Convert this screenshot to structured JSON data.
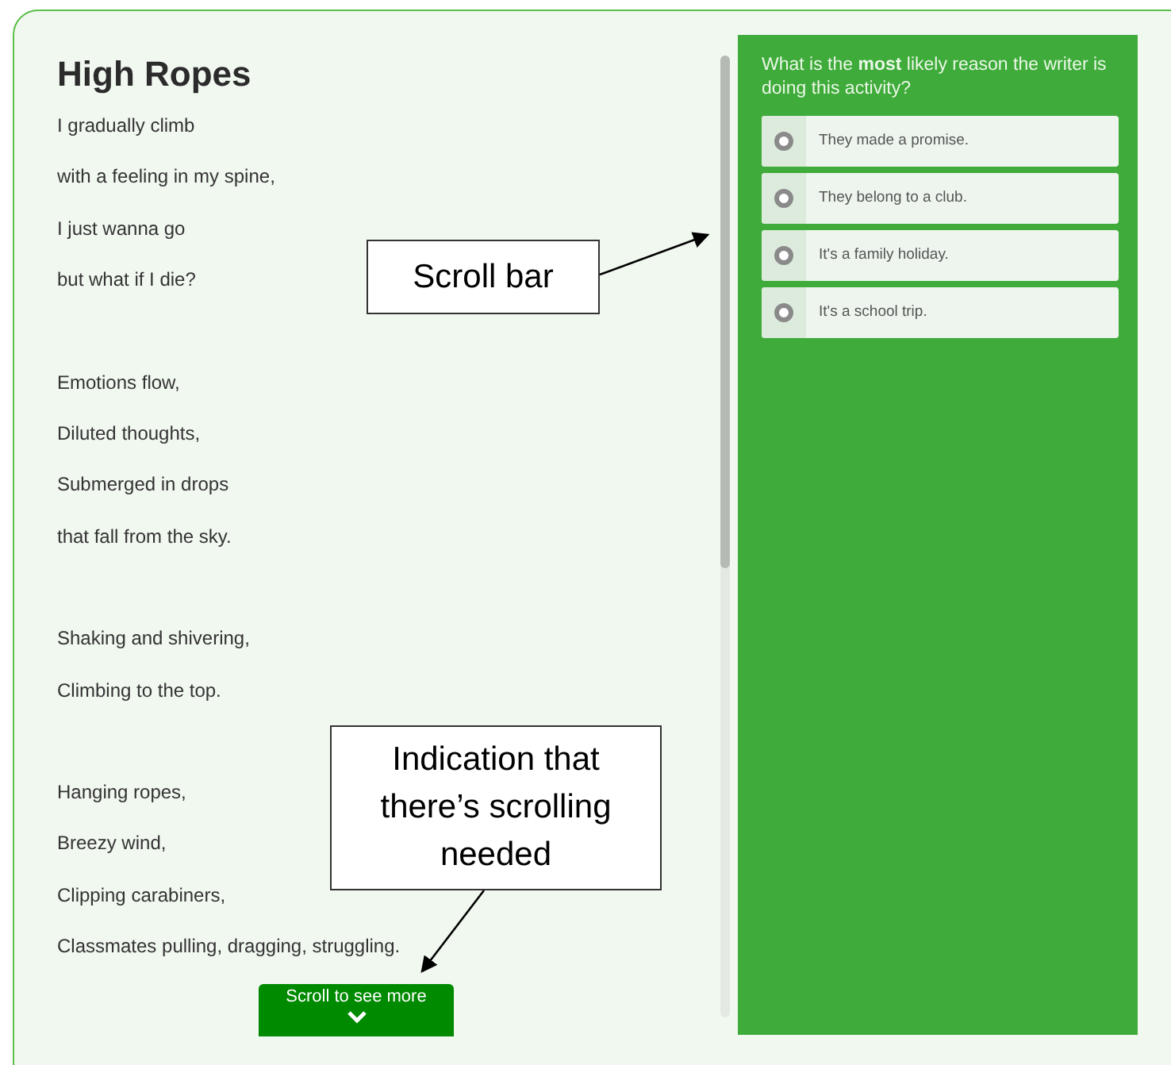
{
  "poem": {
    "title": "High Ropes",
    "stanzas": [
      [
        "I gradually climb",
        "with a feeling in my spine,",
        "I just wanna go",
        "but what if I die?"
      ],
      [
        "Emotions flow,",
        "Diluted thoughts,",
        "Submerged in drops",
        "that fall from the sky."
      ],
      [
        "Shaking and shivering,",
        "Climbing to the top."
      ],
      [
        "Hanging ropes,",
        "Breezy wind,",
        "Clipping carabiners,",
        "Classmates pulling, dragging, struggling."
      ]
    ],
    "scroll_button": "Scroll to see more"
  },
  "question": {
    "text": "What is the **most** likely reason the writer is doing this activity?",
    "options": [
      {
        "label": "They made a promise.",
        "selected": false
      },
      {
        "label": "They belong to a club.",
        "selected": false
      },
      {
        "label": "It's a family holiday.",
        "selected": false
      },
      {
        "label": "It's a school trip.",
        "selected": false
      }
    ]
  },
  "callouts": [
    {
      "text": "Scroll bar"
    },
    {
      "text": "Indication that there’s scrolling needed"
    }
  ]
}
